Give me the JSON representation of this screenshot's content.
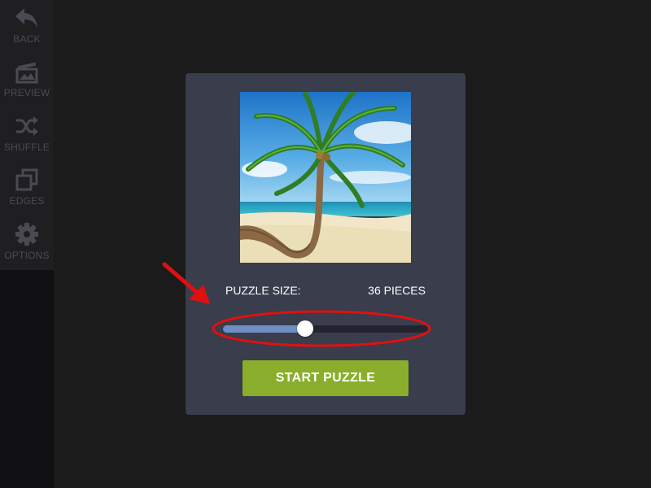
{
  "sidebar": {
    "items": [
      {
        "label": "BACK",
        "icon": "back-arrow-icon"
      },
      {
        "label": "PREVIEW",
        "icon": "preview-image-icon"
      },
      {
        "label": "SHUFFLE",
        "icon": "shuffle-icon"
      },
      {
        "label": "EDGES",
        "icon": "edges-icon"
      },
      {
        "label": "OPTIONS",
        "icon": "gear-icon"
      }
    ]
  },
  "panel": {
    "size_label": "PUZZLE SIZE:",
    "size_value": "36 PIECES",
    "slider_fraction": 0.4,
    "start_label": "START PUZZLE"
  },
  "colors": {
    "background": "#1b1b1b",
    "panel": "#393d4c",
    "slider_fill": "#6f8fc4",
    "slider_track": "#23242e",
    "start_button": "#8aae2b",
    "annotation": "#e01010"
  }
}
